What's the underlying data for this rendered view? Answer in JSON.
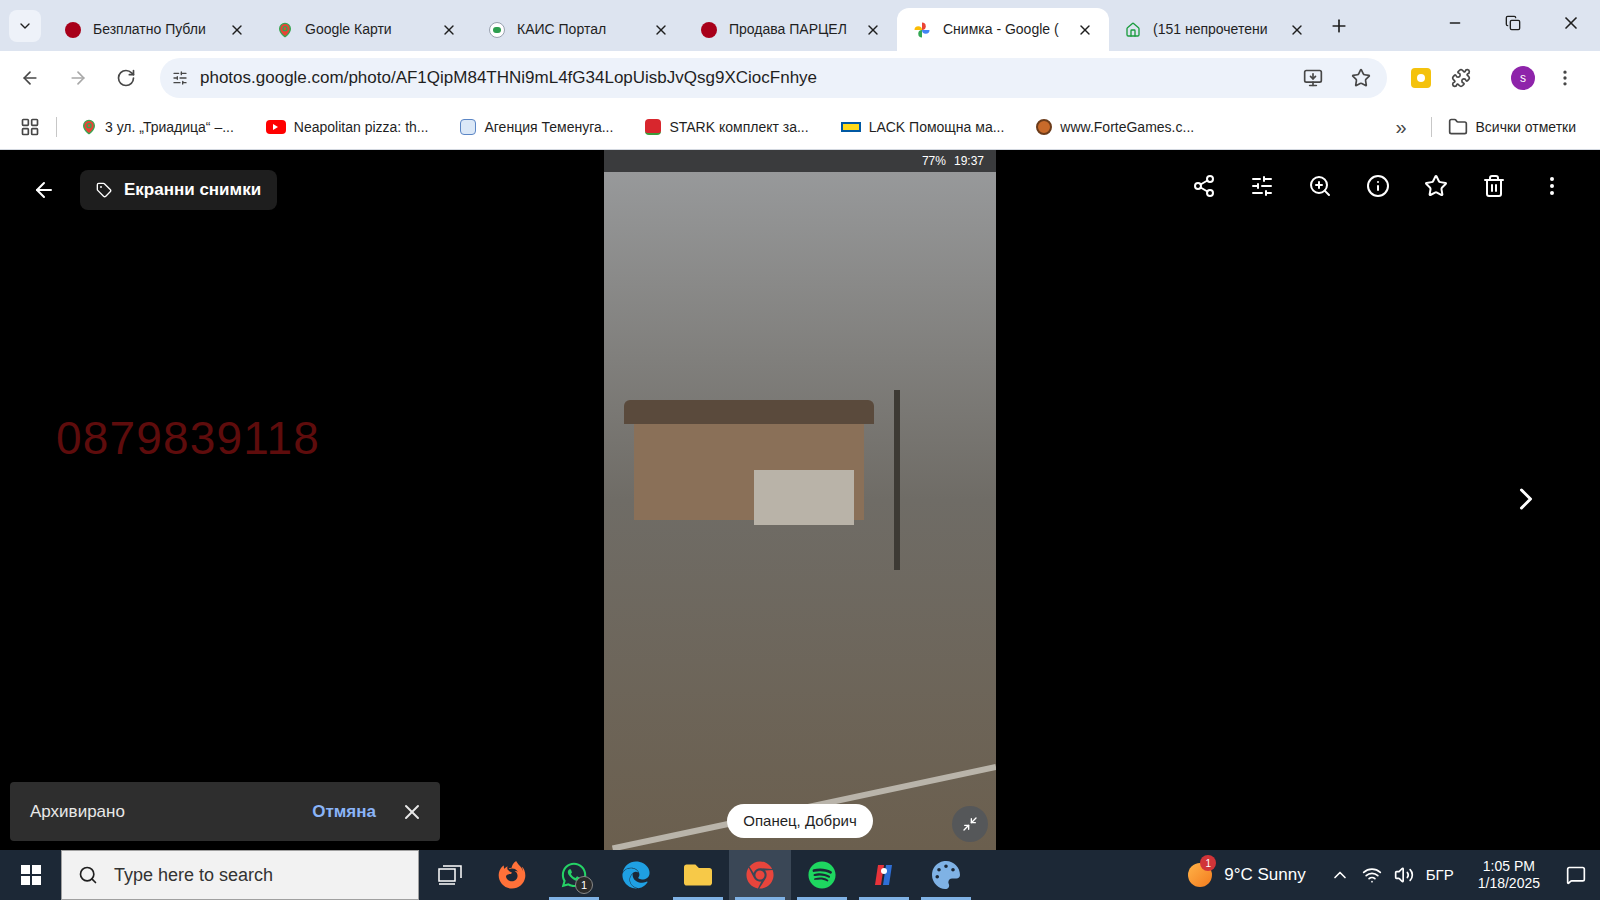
{
  "browser": {
    "tabs": [
      {
        "label": "Безплатно Публи",
        "kind": "red-dot",
        "selected": false
      },
      {
        "label": "Google Карти",
        "kind": "maps",
        "selected": false
      },
      {
        "label": "КАИС Портал",
        "kind": "kais",
        "selected": false
      },
      {
        "label": "Продава ПАРЦЕЛ",
        "kind": "red-dot",
        "selected": false
      },
      {
        "label": "Снимка - Google (",
        "kind": "photos",
        "selected": true
      },
      {
        "label": "(151 непрочетени",
        "kind": "home",
        "selected": false
      }
    ],
    "address": "photos.google.com/photo/AF1QipM84THNi9mL4fG34LopUisbJvQsg9XCiocFnhye",
    "bookmarked": false,
    "profile_initial": "s",
    "bookmarks": [
      {
        "label": "3 ул. „Триадица“ –...",
        "kind": "maps"
      },
      {
        "label": "Neapolitan pizza: th...",
        "kind": "youtube"
      },
      {
        "label": "Агенция Теменуга...",
        "kind": "agency"
      },
      {
        "label": "STARK комплект за...",
        "kind": "stark"
      },
      {
        "label": "LACK Помощна ма...",
        "kind": "lack"
      },
      {
        "label": "www.ForteGames.c...",
        "kind": "forte"
      }
    ],
    "bookmarks_overflow": "»",
    "all_bookmarks": "Всички отметки"
  },
  "viewer": {
    "album": "Екранни снимки",
    "watermark": "0879839118",
    "photo": {
      "battery": "77%",
      "time": "19:37",
      "location": "Опанец, Добрич"
    },
    "snackbar": {
      "message": "Архивирано",
      "action": "Отмяна"
    }
  },
  "taskbar": {
    "search_placeholder": "Type here to search",
    "apps": [
      {
        "kind": "task-view",
        "running": false,
        "selected": false
      },
      {
        "kind": "firefox",
        "running": false,
        "selected": false
      },
      {
        "kind": "whatsapp",
        "running": true,
        "selected": false,
        "badge": "1"
      },
      {
        "kind": "edge",
        "running": false,
        "selected": false
      },
      {
        "kind": "explorer",
        "running": true,
        "selected": false
      },
      {
        "kind": "chrome",
        "running": true,
        "selected": true
      },
      {
        "kind": "spotify",
        "running": true,
        "selected": false
      },
      {
        "kind": "red-app",
        "running": true,
        "selected": false
      },
      {
        "kind": "paint",
        "running": true,
        "selected": false
      }
    ],
    "weather": {
      "temperature": "9°C Sunny",
      "badge": "1"
    },
    "language": "БГР",
    "time": "1:05 PM",
    "date": "1/18/2025"
  }
}
